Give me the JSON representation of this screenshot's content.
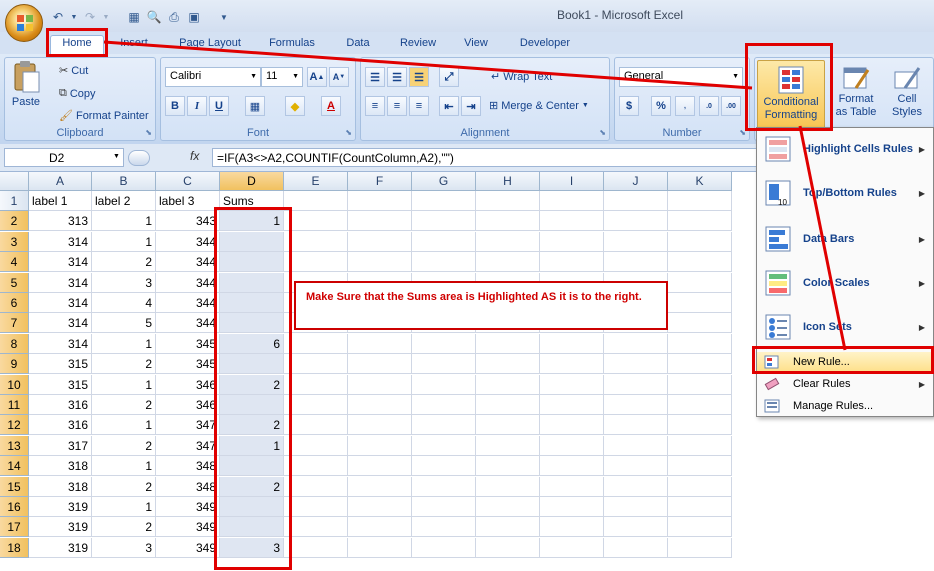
{
  "window": {
    "title": "Book1 - Microsoft Excel"
  },
  "tabs": [
    "Home",
    "Insert",
    "Page Layout",
    "Formulas",
    "Data",
    "Review",
    "View",
    "Developer"
  ],
  "clipboard": {
    "paste": "Paste",
    "cut": "Cut",
    "copy": "Copy",
    "format_painter": "Format Painter",
    "label": "Clipboard"
  },
  "font": {
    "name": "Calibri",
    "size": "11",
    "bold": "B",
    "italic": "I",
    "underline": "U",
    "label": "Font"
  },
  "alignment": {
    "wrap_text": "Wrap Text",
    "merge_center": "Merge & Center",
    "label": "Alignment"
  },
  "number": {
    "format": "General",
    "currency": "$",
    "percent": "%",
    "label": "Number"
  },
  "styles": {
    "conditional_line1": "Conditional",
    "conditional_line2": "Formatting",
    "format_table_line1": "Format",
    "format_table_line2": "as Table",
    "cell_styles_line1": "Cell",
    "cell_styles_line2": "Styles"
  },
  "formula_bar": {
    "name_box": "D2",
    "fx": "fx",
    "formula": "=IF(A3<>A2,COUNTIF(CountColumn,A2),\"\")"
  },
  "columns": [
    "A",
    "B",
    "C",
    "D",
    "E",
    "F",
    "G",
    "H",
    "I",
    "J",
    "K"
  ],
  "header_row": [
    "label 1",
    "label 2",
    "label 3",
    "Sums"
  ],
  "rows": [
    [
      "313",
      "1",
      "343",
      "1"
    ],
    [
      "314",
      "1",
      "344",
      ""
    ],
    [
      "314",
      "2",
      "344",
      ""
    ],
    [
      "314",
      "3",
      "344",
      ""
    ],
    [
      "314",
      "4",
      "344",
      ""
    ],
    [
      "314",
      "5",
      "344",
      ""
    ],
    [
      "314",
      "1",
      "345",
      "6"
    ],
    [
      "315",
      "2",
      "345",
      ""
    ],
    [
      "315",
      "1",
      "346",
      "2"
    ],
    [
      "316",
      "2",
      "346",
      ""
    ],
    [
      "316",
      "1",
      "347",
      "2"
    ],
    [
      "317",
      "2",
      "347",
      "1"
    ],
    [
      "318",
      "1",
      "348",
      ""
    ],
    [
      "318",
      "2",
      "348",
      "2"
    ],
    [
      "319",
      "1",
      "349",
      ""
    ],
    [
      "319",
      "2",
      "349",
      ""
    ],
    [
      "319",
      "3",
      "349",
      "3"
    ]
  ],
  "row_numbers": [
    "1",
    "2",
    "3",
    "4",
    "5",
    "6",
    "7",
    "8",
    "9",
    "10",
    "11",
    "12",
    "13",
    "14",
    "15",
    "16",
    "17",
    "18"
  ],
  "menu": {
    "highlight": "Highlight Cells Rules",
    "topbottom": "Top/Bottom Rules",
    "databars": "Data Bars",
    "colorscales": "Color Scales",
    "iconsets": "Icon Sets",
    "newrule": "New Rule...",
    "clearrules": "Clear Rules",
    "managerules": "Manage Rules..."
  },
  "note": "Make Sure that the Sums area is Highlighted AS it is to the right.",
  "colors": {
    "annotation_red": "#e00000",
    "selection": "#dfe6f2",
    "ribbon": "#d4e1f3"
  }
}
